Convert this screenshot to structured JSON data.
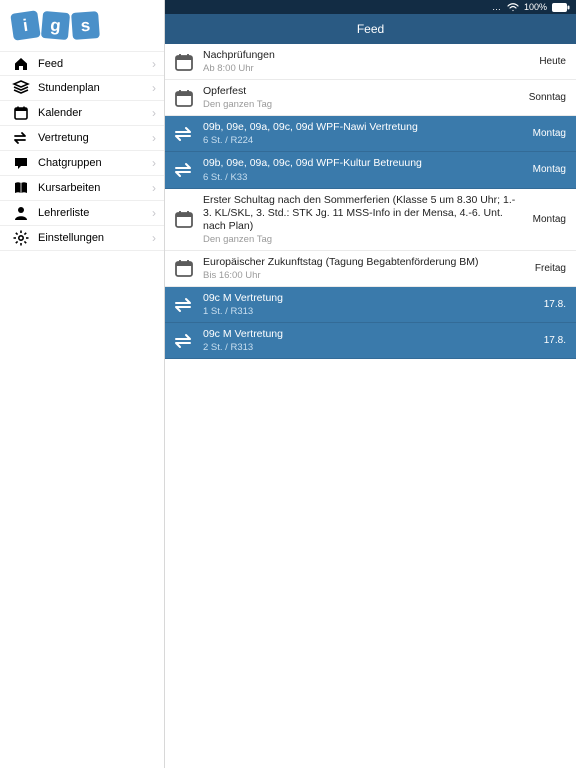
{
  "status": {
    "battery": "100%"
  },
  "logo": {
    "letters": [
      "i",
      "g",
      "s"
    ]
  },
  "header": {
    "title": "Feed"
  },
  "sidebar": {
    "items": [
      {
        "icon": "home",
        "label": "Feed"
      },
      {
        "icon": "stack",
        "label": "Stundenplan"
      },
      {
        "icon": "calendar",
        "label": "Kalender"
      },
      {
        "icon": "swap",
        "label": "Vertretung"
      },
      {
        "icon": "chat",
        "label": "Chatgruppen"
      },
      {
        "icon": "book",
        "label": "Kursarbeiten"
      },
      {
        "icon": "person",
        "label": "Lehrerliste"
      },
      {
        "icon": "gear",
        "label": "Einstellungen"
      }
    ]
  },
  "feed": {
    "items": [
      {
        "kind": "cal",
        "title": "Nachprüfungen",
        "sub": "Ab 8:00 Uhr",
        "day": "Heute"
      },
      {
        "kind": "cal",
        "title": "Opferfest",
        "sub": "Den ganzen Tag",
        "day": "Sonntag"
      },
      {
        "kind": "sub",
        "title": "09b, 09e, 09a, 09c, 09d WPF-Nawi Vertretung",
        "sub": "6 St. / R224",
        "day": "Montag"
      },
      {
        "kind": "sub",
        "title": "09b, 09e, 09a, 09c, 09d WPF-Kultur Betreuung",
        "sub": "6 St. / K33",
        "day": "Montag"
      },
      {
        "kind": "cal",
        "title": "Erster Schultag nach den Sommerferien (Klasse 5 um 8.30 Uhr; 1.- 3. KL/SKL, 3. Std.: STK Jg. 11 MSS-Info in der Mensa, 4.-6. Unt. nach Plan)",
        "sub": "Den ganzen Tag",
        "day": "Montag"
      },
      {
        "kind": "cal",
        "title": "Europäischer Zukunftstag (Tagung Begabtenförderung BM)",
        "sub": "Bis 16:00 Uhr",
        "day": "Freitag"
      },
      {
        "kind": "sub",
        "title": "09c M Vertretung",
        "sub": "1 St. / R313",
        "day": "17.8."
      },
      {
        "kind": "sub",
        "title": "09c M Vertretung",
        "sub": "2 St. / R313",
        "day": "17.8."
      }
    ]
  }
}
